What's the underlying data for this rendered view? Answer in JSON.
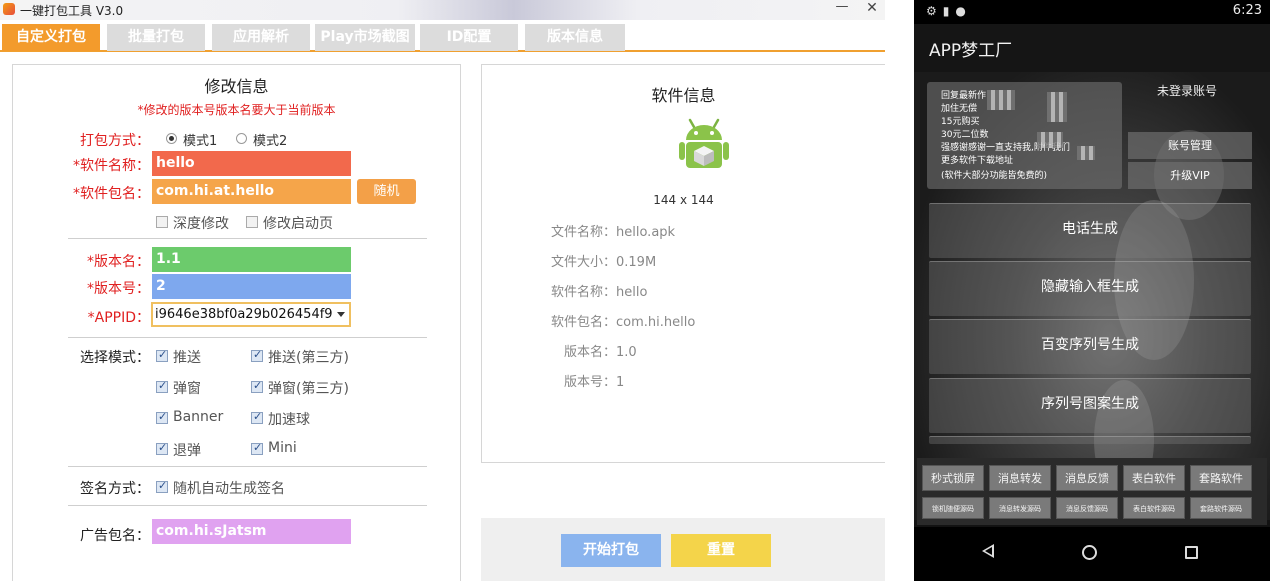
{
  "window": {
    "title": "一键打包工具 V3.0",
    "minimize_glyph": "—",
    "close_glyph": "✕"
  },
  "tabs": [
    {
      "label": "自定义打包",
      "active": true
    },
    {
      "label": "批量打包"
    },
    {
      "label": "应用解析"
    },
    {
      "label": "Play市场截图"
    },
    {
      "label": "ID配置"
    },
    {
      "label": "版本信息"
    }
  ],
  "modify": {
    "title": "修改信息",
    "note": "*修改的版本号版本名要大于当前版本",
    "pack_mode": {
      "label": "打包方式：",
      "options": [
        "模式1",
        "模式2"
      ],
      "selected": "模式1"
    },
    "soft_name": {
      "label": "*软件名称：",
      "value": "hello"
    },
    "package": {
      "label": "*软件包名：",
      "value": "com.hi.at.hello",
      "random_label": "随机"
    },
    "deep_modify": {
      "label": "深度修改",
      "checked": false
    },
    "modify_launch": {
      "label": "修改启动页",
      "checked": false
    },
    "version_name": {
      "label": "*版本名：",
      "value": "1.1"
    },
    "version_code": {
      "label": "*版本号：",
      "value": "2"
    },
    "appid": {
      "label": "*APPID：",
      "value": "i9646e38bf0a29b026454f9"
    },
    "select_mode": {
      "label": "选择模式：",
      "options": [
        {
          "label": "推送",
          "checked": true
        },
        {
          "label": "推送(第三方)",
          "checked": true
        },
        {
          "label": "弹窗",
          "checked": true
        },
        {
          "label": "弹窗(第三方)",
          "checked": true
        },
        {
          "label": "Banner",
          "checked": true
        },
        {
          "label": "加速球",
          "checked": true
        },
        {
          "label": "退弹",
          "checked": true
        },
        {
          "label": "Mini",
          "checked": true
        }
      ]
    },
    "sign": {
      "label": "签名方式：",
      "option": "随机自动生成签名",
      "checked": true
    },
    "ad_package": {
      "label": "广告包名：",
      "value": "com.hi.sJatsm"
    }
  },
  "info": {
    "title": "软件信息",
    "icon_name": "android-box-icon",
    "icon_size": "144 x 144",
    "lines": [
      "文件名称：hello.apk",
      "文件大小：0.19M",
      "软件名称：hello",
      "软件包名：com.hi.hello",
      "版本名：1.0",
      "版本号：1"
    ]
  },
  "actions": {
    "start": "开始打包",
    "reset": "重置"
  },
  "phone": {
    "status_time": "6:23",
    "app_title": "APP梦工厂",
    "login_status": "未登录账号",
    "account_btn": "账号管理",
    "vip_btn": "升级VIP",
    "ad_lines": [
      "回复最新作",
      "加住无偿",
      "15元购买",
      "30元二位数",
      "强感谢感谢一直支持我,附件我们",
      "更多软件下载地址",
      "(软件大部分功能皆免费的)"
    ],
    "menu": [
      "电话生成",
      "隐藏输入框生成",
      "百变序列号生成",
      "序列号图案生成"
    ],
    "tools_row1": [
      "秒式锁屏",
      "消息转发",
      "消息反馈",
      "表白软件",
      "套路软件"
    ],
    "tools_row2": [
      "锁机随便源码",
      "消息转发源码",
      "消息反馈源码",
      "表白软件源码",
      "套路软件源码"
    ]
  },
  "colors": {
    "accent": "#f39b2c",
    "field_name": "#f2694c",
    "field_package": "#f5a54a",
    "field_version_name": "#6ccb6c",
    "field_version_code": "#7ea8ee",
    "field_ad": "#e0a2f0",
    "start_btn": "#8ab4ee",
    "reset_btn": "#f4d44a"
  }
}
